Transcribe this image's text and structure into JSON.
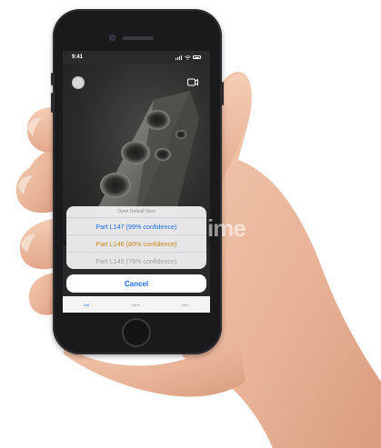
{
  "status_bar": {
    "time": "9:41"
  },
  "icons": {
    "top_left": "circle-button-icon",
    "top_right": "video-camera-icon",
    "signal": "signal-icon",
    "wifi": "wifi-icon",
    "battery": "battery-icon"
  },
  "action_sheet": {
    "title": "Open Default View",
    "options": [
      {
        "label": "Part L147 (99% confidence)",
        "color": "#1e6fe0"
      },
      {
        "label": "Part L146 (80% confidence)",
        "color": "#c9871a"
      },
      {
        "label": "Part L145 (76% confidence)",
        "color": "#a0a0a6"
      }
    ],
    "cancel_label": "Cancel"
  },
  "tab_bar": {
    "items": [
      {
        "label": "List",
        "active": true
      },
      {
        "label": "Parts",
        "active": false
      },
      {
        "label": "Men",
        "active": false
      }
    ]
  },
  "watermark": {
    "text": "ime"
  },
  "colors": {
    "accent": "#1e6fe0",
    "phone_body": "#1a1a1c",
    "sheet_background": "#eeeef0"
  }
}
